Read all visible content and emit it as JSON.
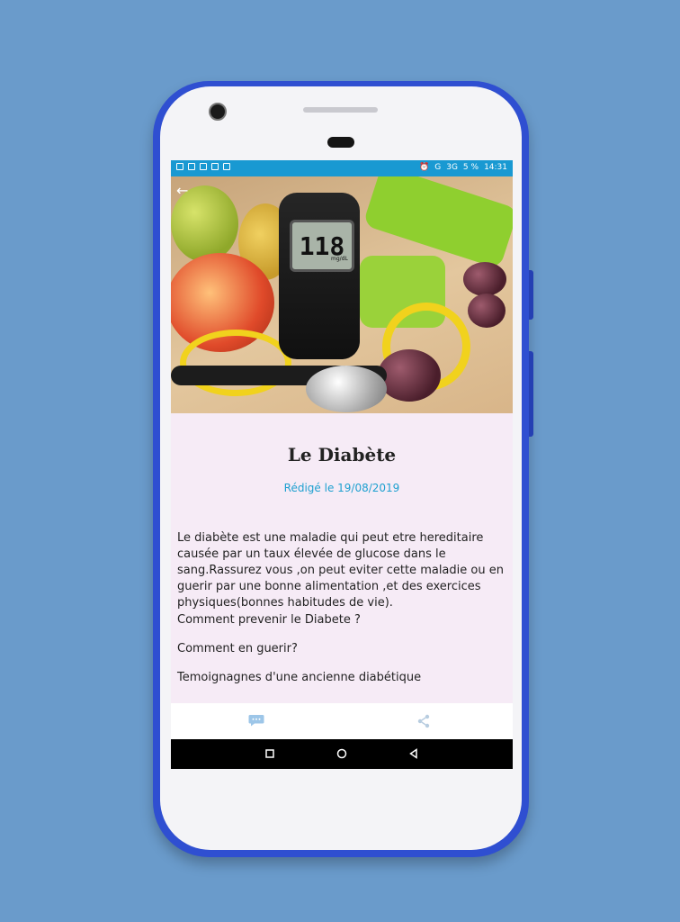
{
  "status_bar": {
    "network": "G",
    "signal": "3G",
    "battery": "5 %",
    "time": "14:31"
  },
  "hero": {
    "meter_value": "118",
    "meter_unit": "mg/dL"
  },
  "article": {
    "title": "Le Diabète",
    "date": "Rédigé le 19/08/2019",
    "intro": "Le diabète est une maladie qui peut etre hereditaire causée par un taux élevée de glucose dans le sang.Rassurez vous ,on peut eviter cette maladie ou en guerir par une bonne alimentation ,et des exercices physiques(bonnes habitudes de vie).",
    "links": [
      "Comment prevenir le Diabete ?",
      "Comment en guerir?",
      "Temoignagnes d'une ancienne diabétique"
    ]
  },
  "icons": {
    "back": "arrow-left-icon",
    "comment": "comment-icon",
    "share": "share-icon",
    "nav_recent": "square-icon",
    "nav_home": "circle-icon",
    "nav_back": "triangle-icon"
  },
  "colors": {
    "background": "#6a9bcb",
    "phone_frame": "#2f4fd1",
    "status_bar": "#1999d2",
    "content_bg": "#f6ebf6",
    "date_color": "#1ea0d0"
  }
}
